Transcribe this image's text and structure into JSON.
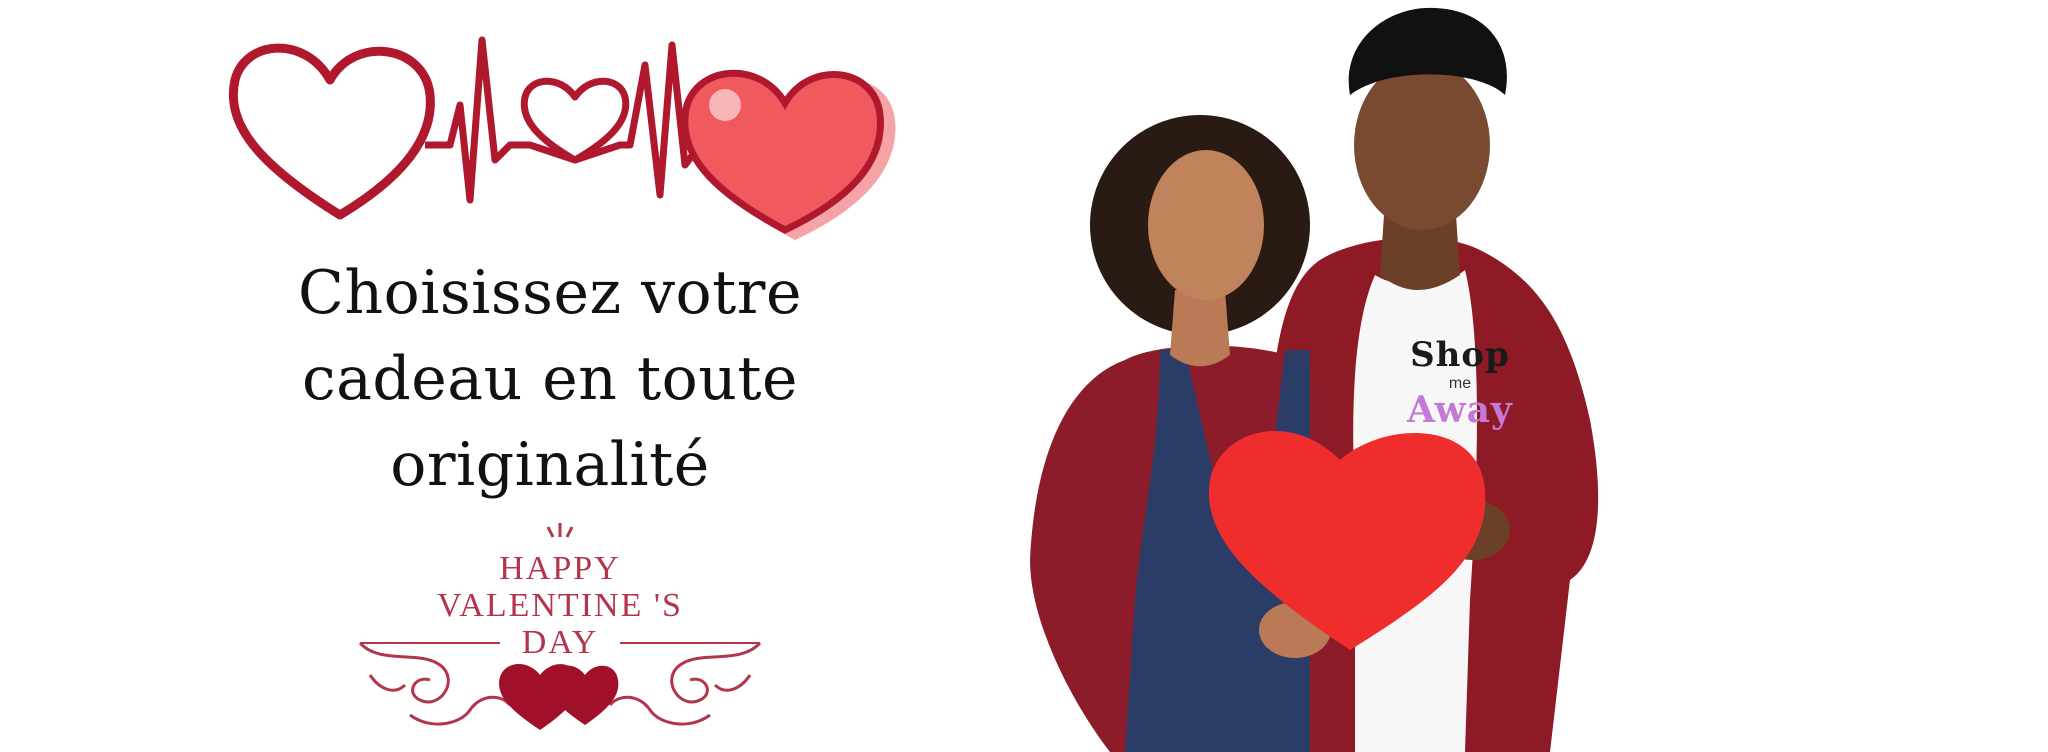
{
  "headline": {
    "line1": "Choisissez votre",
    "line2": "cadeau en toute",
    "line3": "originalité"
  },
  "valentine_emblem": {
    "line1": "HAPPY",
    "line2": "VALENTINE 'S",
    "line3": "DAY"
  },
  "brand": {
    "shop": "Shop",
    "me": "me",
    "away": "Away"
  },
  "colors": {
    "heart_outline": "#b0182e",
    "heart_fill": "#f05a5e",
    "emblem": "#b3354c",
    "shirt_brand_accent": "#c27ad6",
    "red_paper_heart": "#ef2d2d",
    "burgundy": "#8e1a26"
  },
  "icons": [
    "heart-outline-icon",
    "heartbeat-line-icon",
    "heart-filled-icon",
    "ornament-hearts-icon"
  ]
}
